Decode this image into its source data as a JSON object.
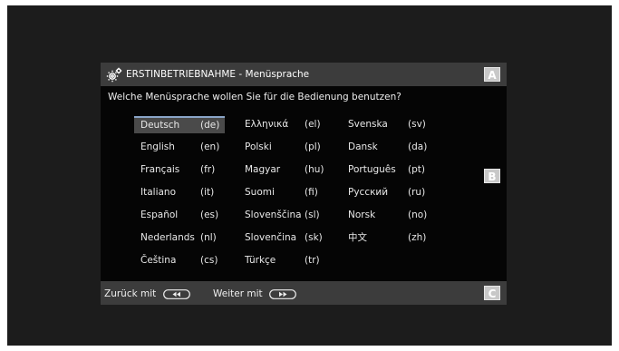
{
  "title_bar": {
    "title": "ERSTINBETRIEBNAHME - Menüsprache",
    "badge": "A",
    "icon": "gear-icon"
  },
  "question": "Welche Menüsprache wollen Sie für die Bedienung benutzen?",
  "side_badge": "B",
  "languages": [
    {
      "name": "Deutsch",
      "code": "(de)",
      "selected": true
    },
    {
      "name": "English",
      "code": "(en)"
    },
    {
      "name": "Français",
      "code": "(fr)"
    },
    {
      "name": "Italiano",
      "code": "(it)"
    },
    {
      "name": "Español",
      "code": "(es)"
    },
    {
      "name": "Nederlands",
      "code": "(nl)"
    },
    {
      "name": "Čeština",
      "code": "(cs)"
    },
    {
      "name": "Ελληνικά",
      "code": "(el)"
    },
    {
      "name": "Polski",
      "code": "(pl)"
    },
    {
      "name": "Magyar",
      "code": "(hu)"
    },
    {
      "name": "Suomi",
      "code": "(fi)"
    },
    {
      "name": "Slovenščina",
      "code": "(sl)"
    },
    {
      "name": "Slovenčina",
      "code": "(sk)"
    },
    {
      "name": "Türkçe",
      "code": "(tr)"
    },
    {
      "name": "Svenska",
      "code": "(sv)"
    },
    {
      "name": "Dansk",
      "code": "(da)"
    },
    {
      "name": "Português",
      "code": "(pt)"
    },
    {
      "name": "Русский",
      "code": "(ru)"
    },
    {
      "name": "Norsk",
      "code": "(no)"
    },
    {
      "name": "中文",
      "code": "(zh)"
    }
  ],
  "footer": {
    "back_label": "Zurück mit",
    "back_icon": "rewind-key-icon",
    "next_label": "Weiter mit",
    "next_icon": "fast-forward-key-icon",
    "badge": "C"
  },
  "colors": {
    "panel": "#050505",
    "bar": "#3c3c3c",
    "selection": "#4a4a4a",
    "highlight": "#8aa5c8",
    "badge": "#c8c8c8"
  }
}
